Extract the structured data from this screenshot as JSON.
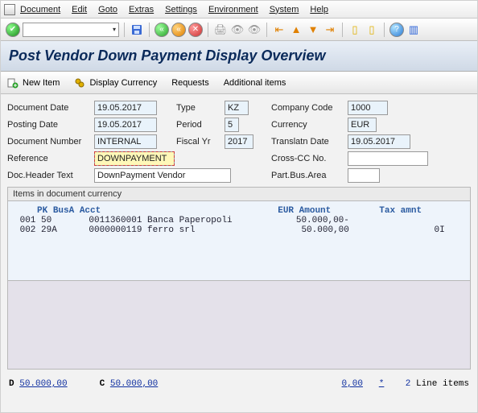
{
  "menu": {
    "items": [
      "Document",
      "Edit",
      "Goto",
      "Extras",
      "Settings",
      "Environment",
      "System",
      "Help"
    ]
  },
  "toolbar": {
    "combo_value": ""
  },
  "title": "Post Vendor Down Payment Display Overview",
  "actionbar": {
    "new_item": "New Item",
    "display_currency": "Display Currency",
    "requests": "Requests",
    "additional": "Additional items"
  },
  "form": {
    "document_date_lbl": "Document Date",
    "document_date": "19.05.2017",
    "type_lbl": "Type",
    "type": "KZ",
    "company_lbl": "Company Code",
    "company": "1000",
    "posting_lbl": "Posting Date",
    "posting": "19.05.2017",
    "period_lbl": "Period",
    "period": "5",
    "currency_lbl": "Currency",
    "currency": "EUR",
    "docnum_lbl": "Document Number",
    "docnum": "INTERNAL",
    "fiscal_lbl": "Fiscal Yr",
    "fiscal": "2017",
    "translate_lbl": "Translatn Date",
    "translate": "19.05.2017",
    "reference_lbl": "Reference",
    "reference": "DOWNPAYMENT",
    "cross_lbl": "Cross-CC No.",
    "cross": "",
    "header_lbl": "Doc.Header Text",
    "header": "DownPayment Vendor",
    "bus_lbl": "Part.Bus.Area",
    "bus": ""
  },
  "items": {
    "group": "Items in document currency",
    "hdr_pk": "PK",
    "hdr_busa": "BusA",
    "hdr_acct": "Acct",
    "hdr_eur": "EUR",
    "hdr_amount": "Amount",
    "hdr_tax": "Tax amnt",
    "rows": [
      {
        "idx": "001",
        "pk": "50",
        "busa": "",
        "acct": "0011360001",
        "name": "Banca Paperopoli",
        "amount": "50.000,00-",
        "tax": ""
      },
      {
        "idx": "002",
        "pk": "29A",
        "busa": "",
        "acct": "0000000119",
        "name": "ferro srl",
        "amount": "50.000,00",
        "tax": "0I"
      }
    ]
  },
  "footer": {
    "d_lbl": "D",
    "d": "50.000,00",
    "c_lbl": "C",
    "c": "50.000,00",
    "diff": "0,00",
    "star": "*",
    "count": "2",
    "count_lbl": "Line items"
  }
}
